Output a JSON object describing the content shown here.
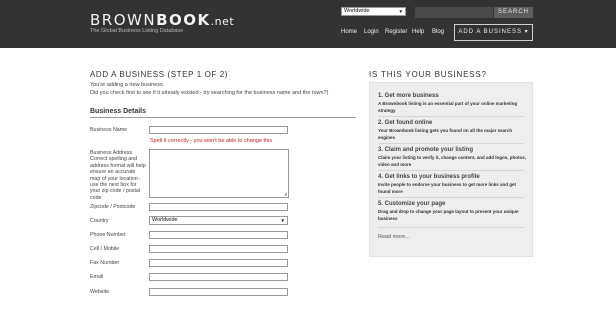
{
  "header": {
    "logo_left": "BROWN",
    "logo_bold": "BOOK",
    "logo_suffix": ".net",
    "tagline": "The Global Business Listing Database",
    "country_value": "Worldwide",
    "search_label": "SEARCH",
    "nav": [
      "Home",
      "Login",
      "Register",
      "Help",
      "Blog"
    ],
    "add_business_label": "ADD A BUSINESS ▾"
  },
  "main": {
    "title": "ADD A BUSINESS (STEP 1 OF 2)",
    "intro_line1": "You're adding a new business.",
    "intro_line2": "Did you check first to see if it already existed - try searching for the business name and the town?)",
    "section_title": "Business Details",
    "spell_hint": "Spell it correctly - you won't be able to change this",
    "fields": {
      "business_name": {
        "label": "Business Name",
        "value": ""
      },
      "business_address": {
        "label": "Business Address",
        "help": "Correct spelling and address format will help ensure an accurate map of your location - use the next box for your zip code / postal code",
        "value": ""
      },
      "zipcode": {
        "label": "Zipcode / Postcode",
        "value": ""
      },
      "country": {
        "label": "Country",
        "value": "Worldwide"
      },
      "phone": {
        "label": "Phone Number",
        "value": ""
      },
      "cell": {
        "label": "Cell / Mobile",
        "value": ""
      },
      "fax": {
        "label": "Fax Number",
        "value": ""
      },
      "email": {
        "label": "Email",
        "value": ""
      },
      "website": {
        "label": "Website",
        "value": ""
      }
    }
  },
  "sidebar": {
    "title": "IS THIS YOUR BUSINESS?",
    "tips": [
      {
        "heading": "1. Get more business",
        "text": "A Brownbook listing is an essential part of your online marketing strategy"
      },
      {
        "heading": "2. Get found online",
        "text": "Your Brownbook listing gets you found on all the major search engines"
      },
      {
        "heading": "3. Claim and promote your listing",
        "text": "Claim your listing to verify it, change content, and add logos, photos, video and more"
      },
      {
        "heading": "4. Get links to your business profile",
        "text": "Invite people to endorse your business to get more links and get found more"
      },
      {
        "heading": "5. Customize your page",
        "text": "Drag and drop to change your page layout to present your unique business"
      }
    ],
    "read_more": "Read more..."
  }
}
